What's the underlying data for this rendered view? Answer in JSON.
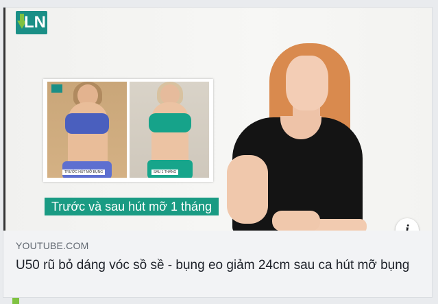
{
  "thumbnail": {
    "logo_text": "LN",
    "inset_caption_before": "TRƯỚC HÚT MỠ BỤNG",
    "inset_caption_after": "SAU 1 THÁNG",
    "banner_text": "Trước và sau hút mỡ 1 tháng",
    "info_label": "i"
  },
  "link": {
    "domain": "YOUTUBE.COM",
    "title": "U50 rũ bỏ dáng vóc sồ sề - bụng eo giảm 24cm sau ca hút mỡ bụng"
  },
  "colors": {
    "brand": "#1a8f86",
    "banner": "#1a9b83",
    "accent": "#7fc241"
  },
  "icons": {
    "info": "info-icon",
    "logo_arrow": "arrow-down-icon"
  }
}
